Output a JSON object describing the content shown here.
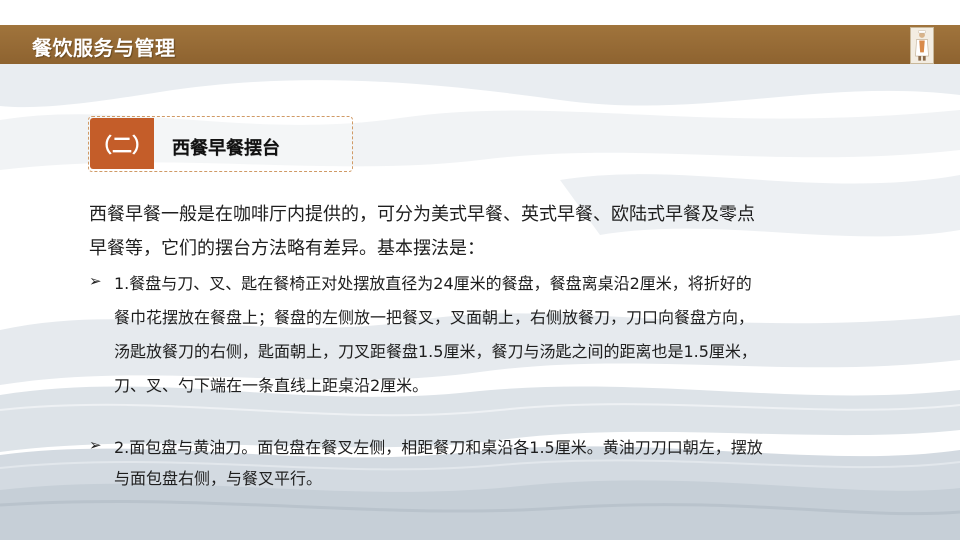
{
  "header": {
    "title": "餐饮服务与管理",
    "accent_color": "#9a6c36"
  },
  "section": {
    "number": "（二）",
    "title": "西餐早餐摆台",
    "number_color": "#c45d29"
  },
  "intro": {
    "lines": [
      "西餐早餐一般是在咖啡厅内提供的，可分为美式早餐、英式早餐、欧陆式早餐及零点",
      "早餐等，它们的摆台方法略有差异。基本摆法是："
    ]
  },
  "bullets": [
    {
      "marker": "➢",
      "lines": [
        "1.餐盘与刀、叉、匙在餐椅正对处摆放直径为24厘米的餐盘，餐盘离桌沿2厘米，将折好的",
        "餐巾花摆放在餐盘上；餐盘的左侧放一把餐叉，叉面朝上，右侧放餐刀，刀口向餐盘方向，",
        "汤匙放餐刀的右侧，匙面朝上，刀叉距餐盘1.5厘米，餐刀与汤匙之间的距离也是1.5厘米，",
        "刀、叉、勺下端在一条直线上距桌沿2厘米。"
      ]
    },
    {
      "marker": "➢",
      "lines": [
        "2.面包盘与黄油刀。面包盘在餐叉左侧，相距餐刀和桌沿各1.5厘米。黄油刀刀口朝左，摆放",
        "与面包盘右侧，与餐叉平行。"
      ]
    }
  ]
}
